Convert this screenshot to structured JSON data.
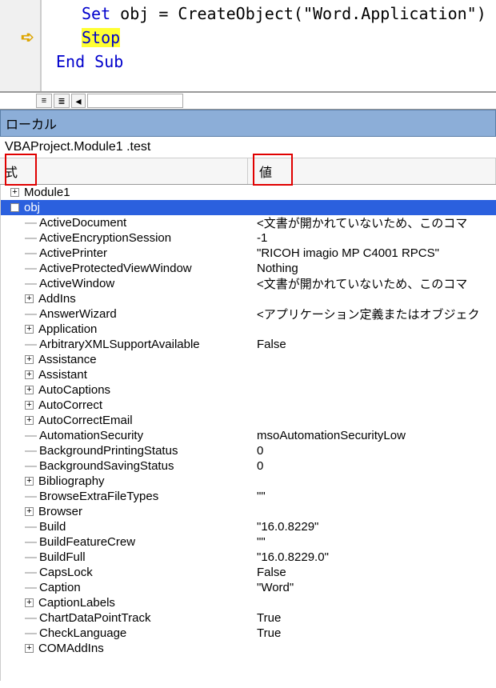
{
  "code": {
    "line1_pre": "Set ",
    "line1_mid": "obj = CreateObject(\"Word.Application\")",
    "line2": "Stop",
    "line3": "End Sub"
  },
  "locals": {
    "title": "ローカル",
    "context": "VBAProject.Module1 .test"
  },
  "columns": {
    "expr": "式",
    "val": "値"
  },
  "rows": [
    {
      "toggle": "plus",
      "name": "Module1",
      "value": "",
      "depth": 0
    },
    {
      "toggle": "minus",
      "name": "obj",
      "value": "",
      "depth": 0,
      "selected": true
    },
    {
      "toggle": "leaf",
      "name": "ActiveDocument",
      "value": "<文書が開かれていないため、このコマ",
      "depth": 1
    },
    {
      "toggle": "leaf",
      "name": "ActiveEncryptionSession",
      "value": "-1",
      "depth": 1
    },
    {
      "toggle": "leaf",
      "name": "ActivePrinter",
      "value": "\"RICOH imagio MP C4001 RPCS\"",
      "depth": 1
    },
    {
      "toggle": "leaf",
      "name": "ActiveProtectedViewWindow",
      "value": "Nothing",
      "depth": 1
    },
    {
      "toggle": "leaf",
      "name": "ActiveWindow",
      "value": "<文書が開かれていないため、このコマ",
      "depth": 1
    },
    {
      "toggle": "plus",
      "name": "AddIns",
      "value": "",
      "depth": 1
    },
    {
      "toggle": "leaf",
      "name": "AnswerWizard",
      "value": "<アプリケーション定義またはオブジェク",
      "depth": 1
    },
    {
      "toggle": "plus",
      "name": "Application",
      "value": "",
      "depth": 1
    },
    {
      "toggle": "leaf",
      "name": "ArbitraryXMLSupportAvailable",
      "value": "False",
      "depth": 1
    },
    {
      "toggle": "plus",
      "name": "Assistance",
      "value": "",
      "depth": 1
    },
    {
      "toggle": "plus",
      "name": "Assistant",
      "value": "",
      "depth": 1
    },
    {
      "toggle": "plus",
      "name": "AutoCaptions",
      "value": "",
      "depth": 1
    },
    {
      "toggle": "plus",
      "name": "AutoCorrect",
      "value": "",
      "depth": 1
    },
    {
      "toggle": "plus",
      "name": "AutoCorrectEmail",
      "value": "",
      "depth": 1
    },
    {
      "toggle": "leaf",
      "name": "AutomationSecurity",
      "value": "msoAutomationSecurityLow",
      "depth": 1
    },
    {
      "toggle": "leaf",
      "name": "BackgroundPrintingStatus",
      "value": "0",
      "depth": 1
    },
    {
      "toggle": "leaf",
      "name": "BackgroundSavingStatus",
      "value": "0",
      "depth": 1
    },
    {
      "toggle": "plus",
      "name": "Bibliography",
      "value": "",
      "depth": 1
    },
    {
      "toggle": "leaf",
      "name": "BrowseExtraFileTypes",
      "value": "\"\"",
      "depth": 1
    },
    {
      "toggle": "plus",
      "name": "Browser",
      "value": "",
      "depth": 1
    },
    {
      "toggle": "leaf",
      "name": "Build",
      "value": "\"16.0.8229\"",
      "depth": 1
    },
    {
      "toggle": "leaf",
      "name": "BuildFeatureCrew",
      "value": "\"\"",
      "depth": 1
    },
    {
      "toggle": "leaf",
      "name": "BuildFull",
      "value": "\"16.0.8229.0\"",
      "depth": 1
    },
    {
      "toggle": "leaf",
      "name": "CapsLock",
      "value": "False",
      "depth": 1
    },
    {
      "toggle": "leaf",
      "name": "Caption",
      "value": "\"Word\"",
      "depth": 1
    },
    {
      "toggle": "plus",
      "name": "CaptionLabels",
      "value": "",
      "depth": 1
    },
    {
      "toggle": "leaf",
      "name": "ChartDataPointTrack",
      "value": "True",
      "depth": 1
    },
    {
      "toggle": "leaf",
      "name": "CheckLanguage",
      "value": "True",
      "depth": 1
    },
    {
      "toggle": "plus",
      "name": "COMAddIns",
      "value": "",
      "depth": 1
    }
  ]
}
